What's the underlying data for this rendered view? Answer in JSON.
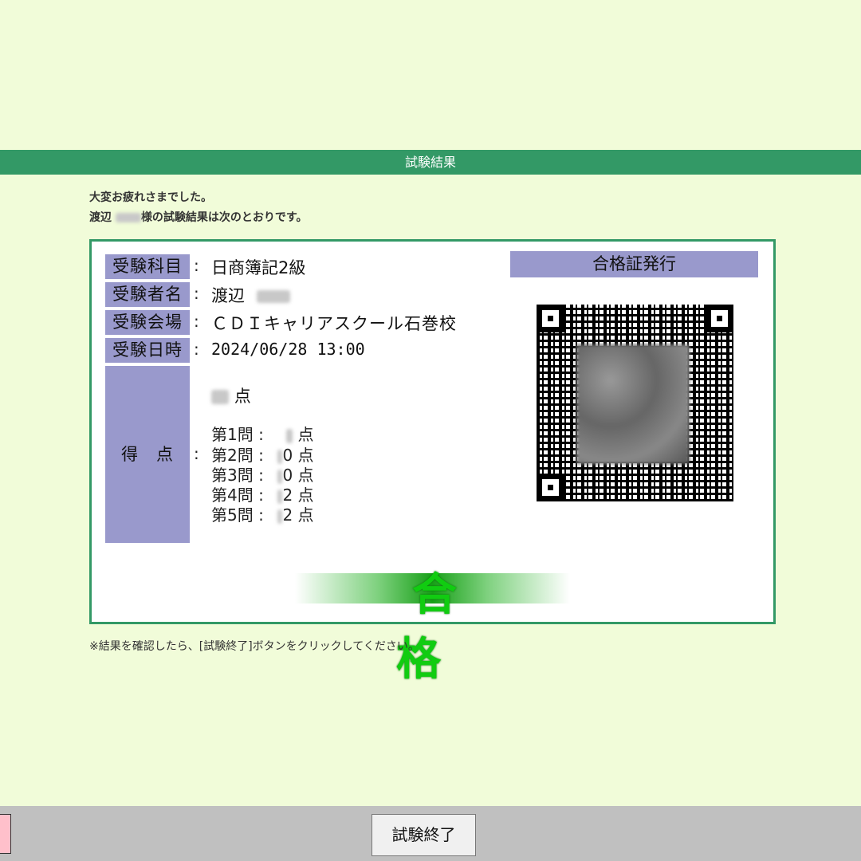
{
  "header": {
    "title": "試験結果"
  },
  "intro": {
    "line1": "大変お疲れさまでした。",
    "line2_prefix": "渡辺",
    "line2_suffix": "様の試験結果は次のとおりです。"
  },
  "result": {
    "labels": {
      "subject": "受験科目",
      "name": "受験者名",
      "venue": "受験会場",
      "datetime": "受験日時",
      "score": "得　点"
    },
    "subject": "日商簿記2級",
    "name_family": "渡辺",
    "venue": "ＣＤＩキャリアスクール石巻校",
    "datetime": "2024/06/28 13:00",
    "point_unit": "点",
    "questions": [
      {
        "label": "第1問",
        "value": "",
        "unit": "点"
      },
      {
        "label": "第2問",
        "value": "0",
        "unit": "点"
      },
      {
        "label": "第3問",
        "value": "0",
        "unit": "点"
      },
      {
        "label": "第4問",
        "value": "2",
        "unit": "点"
      },
      {
        "label": "第5問",
        "value": "2",
        "unit": "点"
      }
    ],
    "certificate_title": "合格証発行",
    "verdict": "合格"
  },
  "note": "※結果を確認したら、[試験終了]ボタンをクリックしてください。",
  "footer": {
    "end_button": "試験終了"
  }
}
